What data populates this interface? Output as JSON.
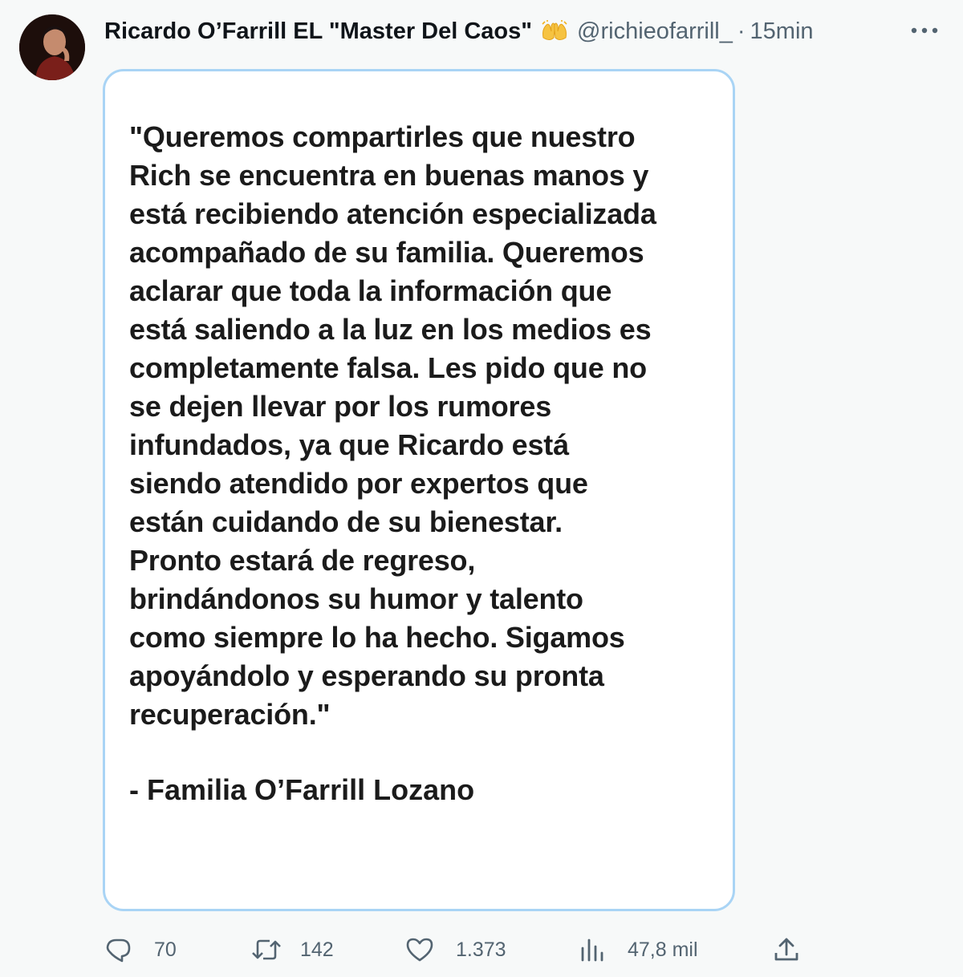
{
  "author": {
    "name": "Ricardo O’Farrill EL \"Master Del Caos\"",
    "badge_icon": "raising-hands-icon",
    "handle": "@richieofarrill_",
    "separator": "·",
    "time": "15min"
  },
  "media_card": {
    "quote": "\"Queremos compartirles que nuestro\nRich se encuentra en buenas manos y\nestá recibiendo atención especializada\nacompañado de su familia. Queremos\naclarar que toda la información que\nestá saliendo a la luz en los medios es\ncompletamente falsa. Les pido que no\nse dejen llevar por los rumores\ninfundados, ya que Ricardo está\nsiendo atendido por expertos que\nestán cuidando de su bienestar.\nPronto estará de regreso,\nbrindándonos su humor y talento\ncomo siempre lo ha hecho. Sigamos\napoyándolo y esperando su pronta\nrecuperación.\"",
    "signature": "- Familia O’Farrill Lozano"
  },
  "actions": {
    "replies": "70",
    "retweets": "142",
    "likes": "1.373",
    "views": "47,8 mil"
  },
  "colors": {
    "secondary_text": "#536471",
    "card_border": "#a9d4f5",
    "background": "#f7f9f9"
  }
}
